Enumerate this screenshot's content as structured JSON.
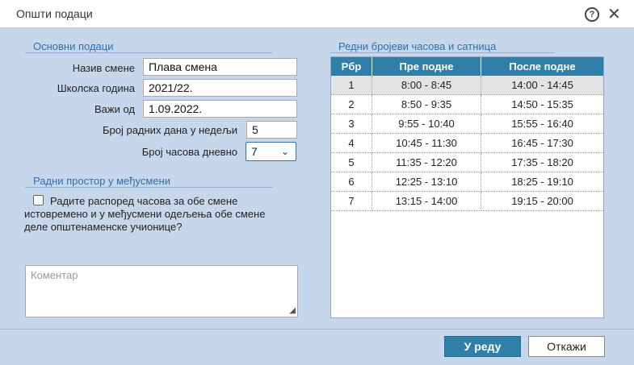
{
  "window": {
    "title": "Општи подаци"
  },
  "basic": {
    "section_title": "Основни подаци",
    "shift_name_label": "Назив смене",
    "shift_name_value": "Плава смена",
    "school_year_label": "Школска година",
    "school_year_value": "2021/22.",
    "valid_from_label": "Важи од",
    "valid_from_value": "1.09.2022.",
    "working_days_label": "Број радних дана у недељи",
    "working_days_value": "5",
    "classes_per_day_label": "Број часова дневно",
    "classes_per_day_value": "7"
  },
  "workspace": {
    "section_title": "Радни простор у међусмени",
    "checkbox_text": "Радите распоред часова за обе смене истовремено и у међусмени одељења обе смене деле општенаменске учионице?",
    "checked": false
  },
  "comment": {
    "placeholder": "Коментар"
  },
  "schedule": {
    "section_title": "Редни бројеви часова и сатница",
    "headers": [
      "Рбр",
      "Пре подне",
      "После подне"
    ],
    "rows": [
      [
        "1",
        "8:00 - 8:45",
        "14:00 - 14:45"
      ],
      [
        "2",
        "8:50 - 9:35",
        "14:50 - 15:35"
      ],
      [
        "3",
        "9:55 - 10:40",
        "15:55 - 16:40"
      ],
      [
        "4",
        "10:45 - 11:30",
        "16:45 - 17:30"
      ],
      [
        "5",
        "11:35 - 12:20",
        "17:35 - 18:20"
      ],
      [
        "6",
        "12:25 - 13:10",
        "18:25 - 19:10"
      ],
      [
        "7",
        "13:15 - 14:00",
        "19:15 - 20:00"
      ]
    ]
  },
  "buttons": {
    "ok": "У реду",
    "cancel": "Откажи"
  }
}
